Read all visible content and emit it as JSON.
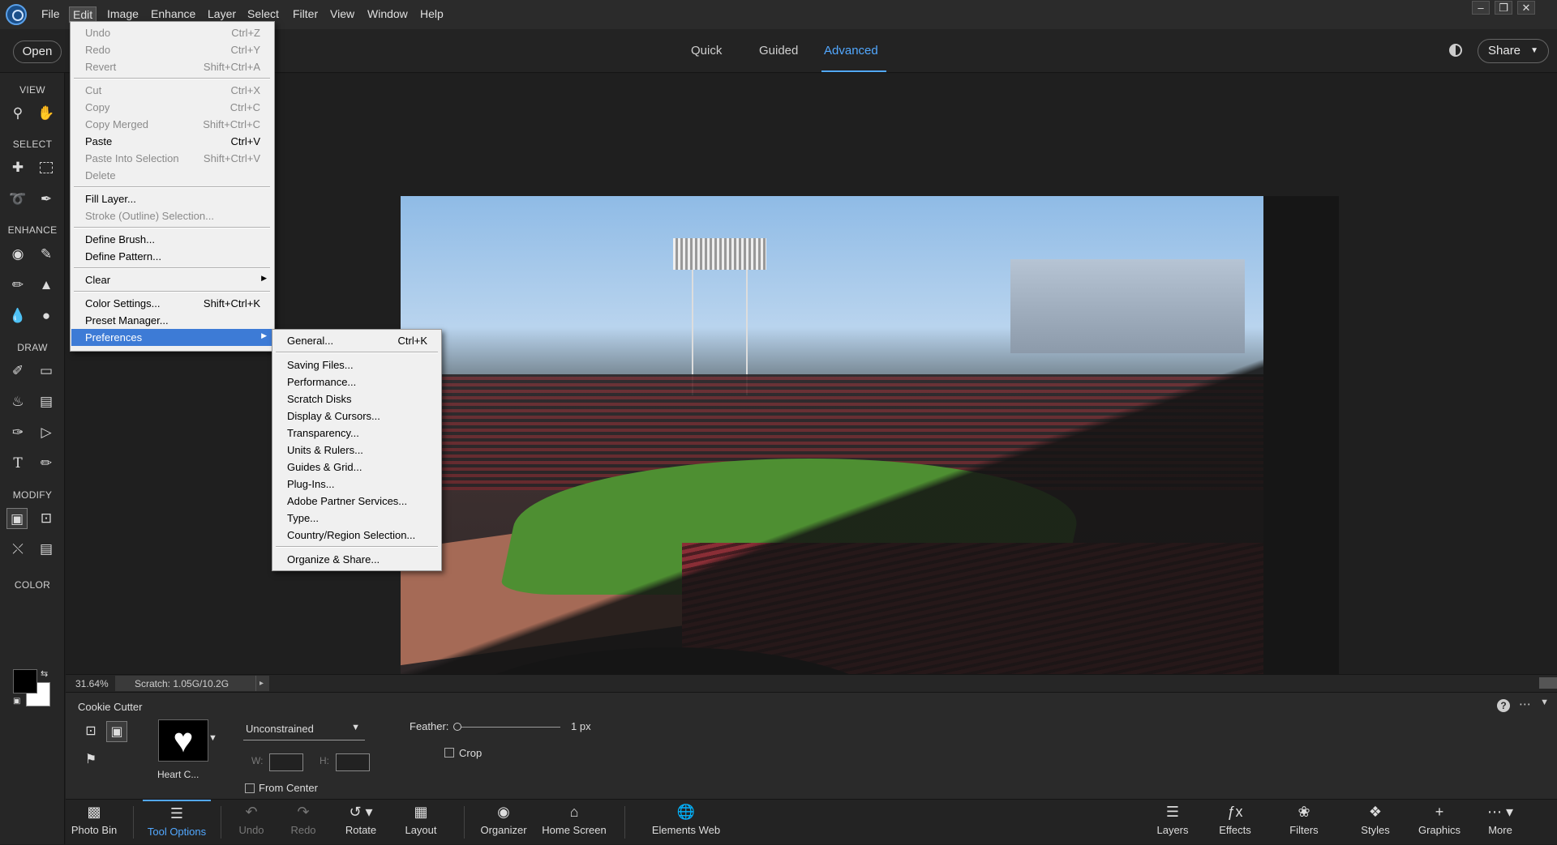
{
  "menubar": {
    "items": [
      "File",
      "Edit",
      "Image",
      "Enhance",
      "Layer",
      "Select",
      "Filter",
      "View",
      "Window",
      "Help"
    ],
    "window_controls": {
      "minimize": "–",
      "restore": "❐",
      "close": "✕"
    }
  },
  "topbar": {
    "open_label": "Open",
    "modes": [
      "Quick",
      "Guided",
      "Advanced"
    ],
    "active_mode": "Advanced",
    "share_label": "Share",
    "accent_color": "#52a8ff"
  },
  "toolbar": {
    "sections": {
      "view": "VIEW",
      "select": "SELECT",
      "enhance": "ENHANCE",
      "draw": "DRAW",
      "modify": "MODIFY",
      "color": "COLOR"
    },
    "tool_icons": [
      "zoom-icon",
      "hand-icon",
      "move-icon",
      "marquee-icon",
      "lasso-icon",
      "quick-selection-icon",
      "red-eye-icon",
      "spot-healing-icon",
      "smart-brush-icon",
      "clone-stamp-icon",
      "blur-icon",
      "sponge-icon",
      "brush-icon",
      "eraser-icon",
      "paint-bucket-icon",
      "gradient-icon",
      "eyedropper-icon",
      "custom-shape-icon",
      "type-icon",
      "pencil-icon",
      "cookie-cutter-icon",
      "crop-icon",
      "recompose-icon",
      "straighten-icon"
    ],
    "foreground_color": "#000000",
    "background_color": "#ffffff"
  },
  "status": {
    "zoom": "31.64%",
    "scratch": "Scratch: 1.05G/10.2G"
  },
  "tool_options": {
    "tool_name": "Cookie Cutter",
    "shape_name": "Heart C...",
    "constraint": "Unconstrained",
    "w_label": "W:",
    "h_label": "H:",
    "from_center": "From Center",
    "feather_label": "Feather:",
    "feather_value": "1 px",
    "crop_label": "Crop"
  },
  "taskbar": {
    "photo_bin": "Photo Bin",
    "tool_options": "Tool Options",
    "undo": "Undo",
    "redo": "Redo",
    "rotate": "Rotate",
    "layout": "Layout",
    "organizer": "Organizer",
    "home_screen": "Home Screen",
    "elements_web": "Elements Web",
    "layers": "Layers",
    "effects": "Effects",
    "filters": "Filters",
    "styles": "Styles",
    "graphics": "Graphics",
    "more": "More"
  },
  "edit_menu": {
    "undo": {
      "label": "Undo",
      "shortcut": "Ctrl+Z"
    },
    "redo": {
      "label": "Redo",
      "shortcut": "Ctrl+Y"
    },
    "revert": {
      "label": "Revert",
      "shortcut": "Shift+Ctrl+A"
    },
    "cut": {
      "label": "Cut",
      "shortcut": "Ctrl+X"
    },
    "copy": {
      "label": "Copy",
      "shortcut": "Ctrl+C"
    },
    "copy_merged": {
      "label": "Copy Merged",
      "shortcut": "Shift+Ctrl+C"
    },
    "paste": {
      "label": "Paste",
      "shortcut": "Ctrl+V"
    },
    "paste_into": {
      "label": "Paste Into Selection",
      "shortcut": "Shift+Ctrl+V"
    },
    "delete": {
      "label": "Delete"
    },
    "fill_layer": {
      "label": "Fill Layer..."
    },
    "stroke": {
      "label": "Stroke (Outline) Selection..."
    },
    "define_brush": {
      "label": "Define Brush..."
    },
    "define_pattern": {
      "label": "Define Pattern..."
    },
    "clear": {
      "label": "Clear"
    },
    "color_settings": {
      "label": "Color Settings...",
      "shortcut": "Shift+Ctrl+K"
    },
    "preset_manager": {
      "label": "Preset Manager..."
    },
    "preferences": {
      "label": "Preferences"
    }
  },
  "preferences_menu": {
    "general": {
      "label": "General...",
      "shortcut": "Ctrl+K"
    },
    "saving_files": "Saving Files...",
    "performance": "Performance...",
    "scratch_disks": "Scratch Disks",
    "display_cursors": "Display & Cursors...",
    "transparency": "Transparency...",
    "units_rulers": "Units & Rulers...",
    "guides_grid": "Guides & Grid...",
    "plugins": "Plug-Ins...",
    "adobe_partner": "Adobe Partner Services...",
    "type": "Type...",
    "country_region": "Country/Region Selection...",
    "organize_share": "Organize & Share..."
  }
}
